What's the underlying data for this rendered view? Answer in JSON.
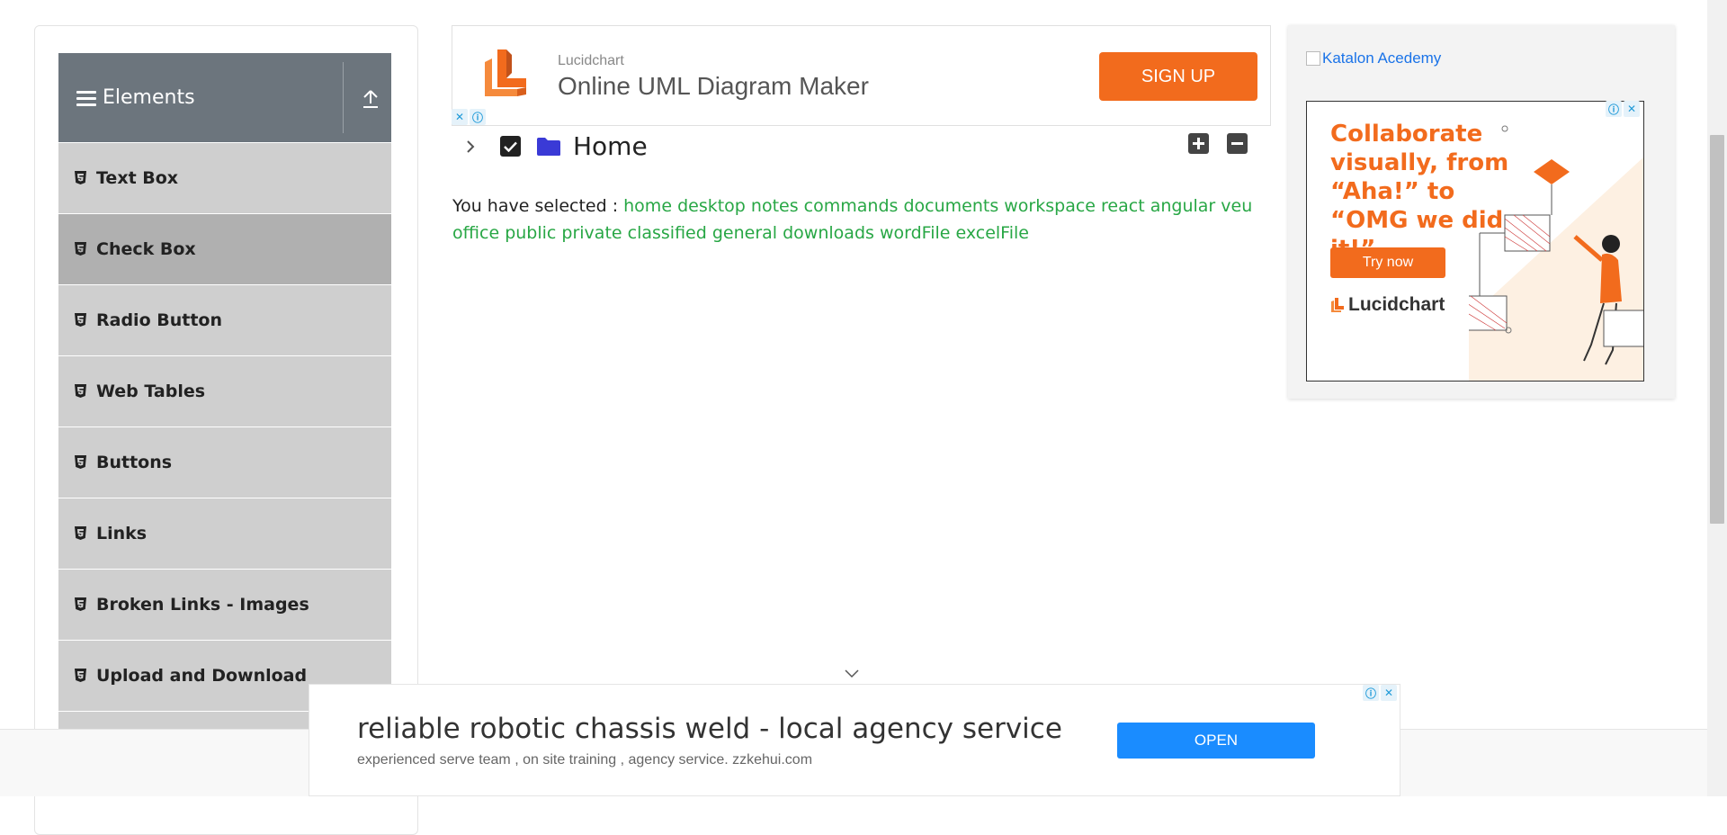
{
  "sidebar": {
    "group_title": "Elements",
    "items": [
      {
        "label": "Text Box"
      },
      {
        "label": "Check Box"
      },
      {
        "label": "Radio Button"
      },
      {
        "label": "Web Tables"
      },
      {
        "label": "Buttons"
      },
      {
        "label": "Links"
      },
      {
        "label": "Broken Links - Images"
      },
      {
        "label": "Upload and Download"
      }
    ],
    "active_item": "Check Box"
  },
  "top_ad": {
    "brand": "Lucidchart",
    "headline": "Online UML Diagram Maker",
    "cta": "SIGN UP",
    "accent": "#f26b1d"
  },
  "tree": {
    "root_label": "Home",
    "checked": true
  },
  "result": {
    "prefix": "You have selected :",
    "selected": [
      "home",
      "desktop",
      "notes",
      "commands",
      "documents",
      "workspace",
      "react",
      "angular",
      "veu",
      "office",
      "public",
      "private",
      "classified",
      "general",
      "downloads",
      "wordFile",
      "excelFile"
    ],
    "highlight_color": "#28a745"
  },
  "right_ad": {
    "link_text": "Katalon Acedemy",
    "tagline": "Collaborate visually, from “Aha!” to “OMG we did it!”",
    "cta": "Try now",
    "brand": "Lucidchart"
  },
  "bottom_ad": {
    "headline": "reliable robotic chassis weld - local agency service",
    "sub": "experienced serve team , on site training , agency service. zzkehui.com",
    "cta": "OPEN",
    "button_color": "#1a8cff"
  },
  "ad_badge": {
    "info": "ⓘ",
    "close": "✕"
  }
}
